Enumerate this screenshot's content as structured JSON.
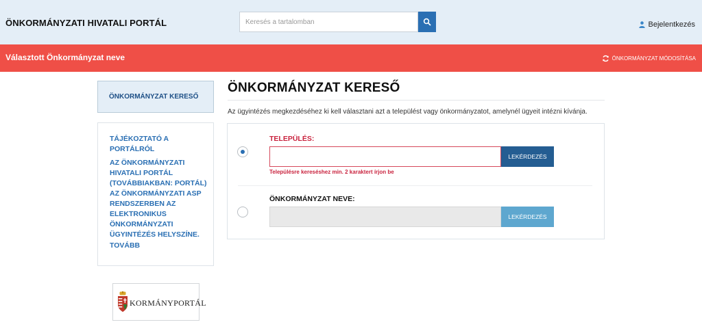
{
  "header": {
    "site_title": "ÖNKORMÁNYZATI HIVATALI PORTÁL",
    "search_placeholder": "Keresés a tartalomban",
    "login_label": "Bejelentkezés"
  },
  "municipality_bar": {
    "name": "Választott Önkormányzat neve",
    "modify_label": "ÖNKORMÁNYZAT MÓDOSÍTÁSA"
  },
  "sidebar": {
    "active_item": "ÖNKORMÁNYZAT KERESŐ",
    "info_link_title": [
      "TÁJÉKOZTATÓ A",
      "PORTÁLRÓL"
    ],
    "info_text": [
      "AZ ÖNKORMÁNYZATI",
      "HIVATALI PORTÁL",
      "(TOVÁBBIAKBAN: PORTÁL)",
      "AZ ÖNKORMÁNYZATI ASP",
      "RENDSZERBEN AZ",
      "ELEKTRONIKUS",
      "ÖNKORMÁNYZATI",
      "ÜGYINTÉZÉS HELYSZÍNE."
    ],
    "more_label": "TOVÁBB",
    "logo_text": "KORMÁNYPORTÁL"
  },
  "main": {
    "title": "ÖNKORMÁNYZAT KERESŐ",
    "intro": "Az ügyintézés megkezdéséhez ki kell választani azt a települést vagy önkormányzatot, amelynél ügyeit intézni kívánja.",
    "settlement": {
      "label": "TELEPÜLÉS:",
      "value": "",
      "button": "LEKÉRDEZÉS",
      "error": "Településre kereséshez min. 2 karaktert írjon be",
      "selected": true
    },
    "municipality": {
      "label": "ÖNKORMÁNYZAT NEVE:",
      "value": "",
      "button": "LEKÉRDEZÉS",
      "selected": false
    }
  },
  "colors": {
    "header_bg": "#e4eef7",
    "accent_red": "#ef4f47",
    "primary_blue": "#245d92",
    "disabled_blue": "#5ea7cf",
    "error_red": "#c9233e"
  }
}
